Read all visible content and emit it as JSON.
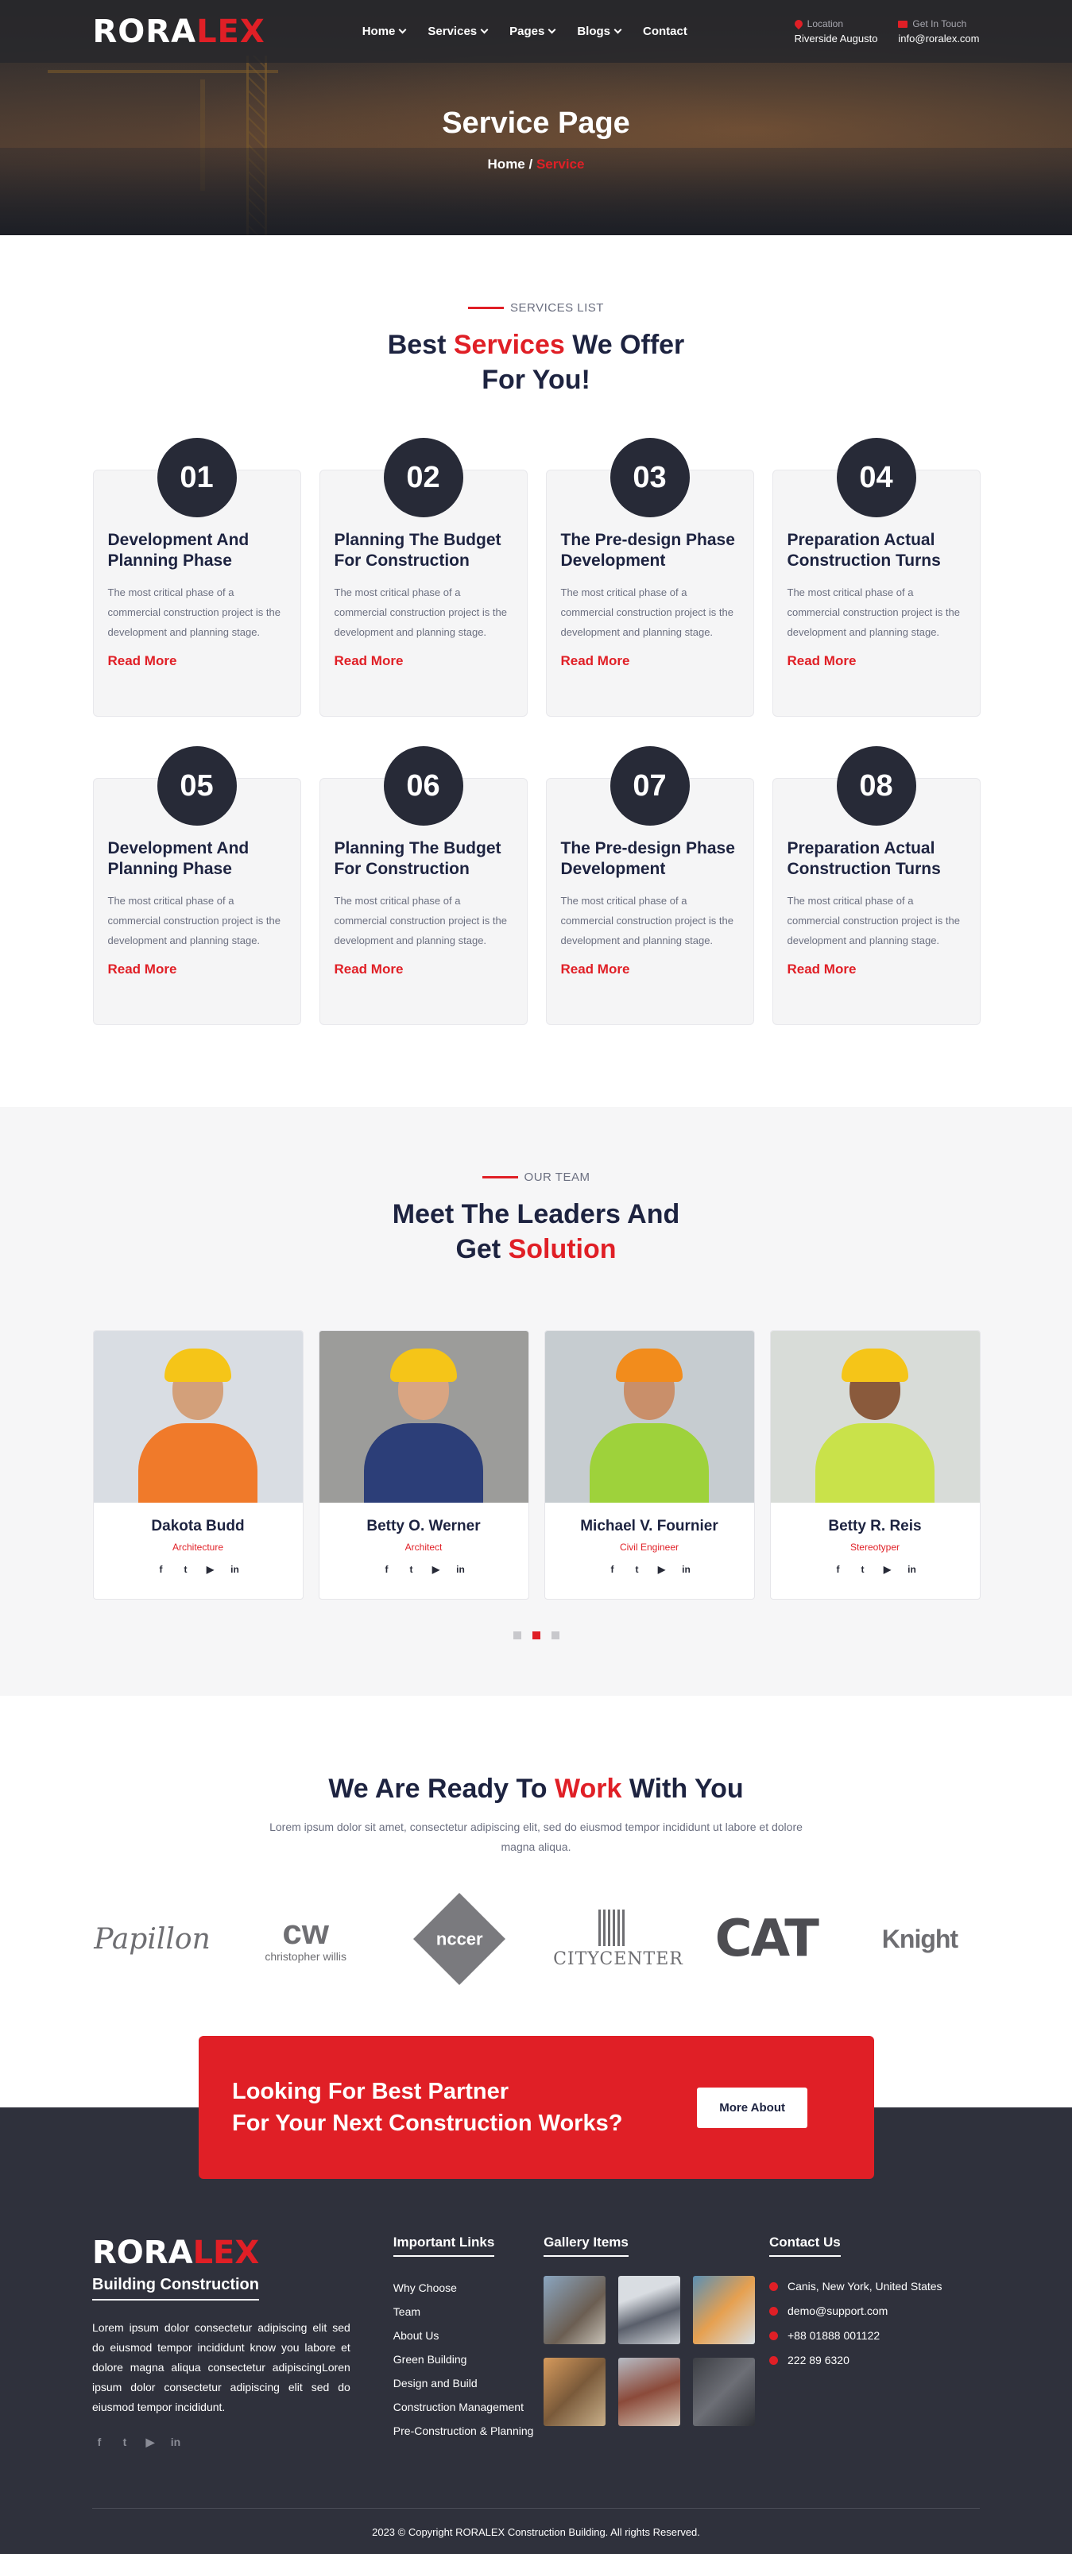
{
  "brand": {
    "logo_main": "RORA",
    "logo_accent": "LEX"
  },
  "nav": {
    "items": [
      "Home",
      "Services",
      "Pages",
      "Blogs",
      "Contact"
    ],
    "location_label": "Location",
    "location_value": "Riverside Augusto",
    "touch_label": "Get In Touch",
    "touch_value": "info@roralex.com"
  },
  "hero": {
    "title": "Service Page",
    "crumb_home": "Home",
    "crumb_sep": "/",
    "crumb_current": "Service"
  },
  "services": {
    "tag": "SERVICES LIST",
    "title_pre": "Best ",
    "title_accent": "Services",
    "title_post": " We Offer",
    "title_line2": "For You!",
    "cards": [
      {
        "num": "01",
        "title": "Development And Planning Phase",
        "text": "The most critical phase of a commercial construction project is the development and planning stage.",
        "link": "Read More"
      },
      {
        "num": "02",
        "title": "Planning The Budget For Construction",
        "text": "The most critical phase of a commercial construction project is the development and planning stage.",
        "link": "Read More"
      },
      {
        "num": "03",
        "title": "The Pre-design Phase Development",
        "text": "The most critical phase of a commercial construction project is the development and planning stage.",
        "link": "Read More"
      },
      {
        "num": "04",
        "title": "Preparation Actual Construction Turns",
        "text": "The most critical phase of a commercial construction project is the development and planning stage.",
        "link": "Read More"
      },
      {
        "num": "05",
        "title": "Development And Planning Phase",
        "text": "The most critical phase of a commercial construction project is the development and planning stage.",
        "link": "Read More"
      },
      {
        "num": "06",
        "title": "Planning The Budget For Construction",
        "text": "The most critical phase of a commercial construction project is the development and planning stage.",
        "link": "Read More"
      },
      {
        "num": "07",
        "title": "The Pre-design Phase Development",
        "text": "The most critical phase of a commercial construction project is the development and planning stage.",
        "link": "Read More"
      },
      {
        "num": "08",
        "title": "Preparation Actual Construction Turns",
        "text": "The most critical phase of a commercial construction project is the development and planning stage.",
        "link": "Read More"
      }
    ]
  },
  "team": {
    "tag": "OUR TEAM",
    "title_line1": "Meet The Leaders And",
    "title_pre2": "Get ",
    "title_accent2": "Solution",
    "members": [
      {
        "name": "Dakota Budd",
        "role": "Architecture"
      },
      {
        "name": "Betty O. Werner",
        "role": "Architect"
      },
      {
        "name": "Michael V. Fournier",
        "role": "Civil Engineer"
      },
      {
        "name": "Betty R. Reis",
        "role": "Stereotyper"
      }
    ],
    "social_icons": [
      "facebook-icon",
      "twitter-icon",
      "youtube-icon",
      "linkedin-icon"
    ]
  },
  "ready": {
    "title_pre": "We Are Ready To ",
    "title_accent": "Work",
    "title_post": " With You",
    "text": "Lorem ipsum dolor sit amet, consectetur adipiscing elit, sed do eiusmod tempor incididunt ut labore et dolore magna aliqua.",
    "brands": [
      "Papillon",
      "christopher willis",
      "nccer",
      "CITYCENTER",
      "CAT",
      "Knight"
    ]
  },
  "cta": {
    "line1": "Looking For Best Partner",
    "line2": "For Your Next Construction Works?",
    "button": "More About"
  },
  "footer": {
    "subtitle": "Building Construction",
    "desc": "Lorem ipsum dolor consectetur adipiscing elit sed do eiusmod tempor incididunt know you labore et dolore magna aliqua consectetur adipiscingLoren ipsum dolor consectetur adipiscing elit sed do eiusmod tempor incididunt.",
    "links_title": "Important Links",
    "links": [
      "Why Choose",
      "Team",
      "About Us",
      "Green Building",
      "Design and Build",
      "Construction Management",
      "Pre-Construction & Planning"
    ],
    "gallery_title": "Gallery Items",
    "contact_title": "Contact Us",
    "contact": [
      "Canis, New York, United States",
      "demo@support.com",
      "+88 01888 001122",
      "222 89 6320"
    ],
    "copyright": "2023 © Copyright RORALEX Construction Building. All rights Reserved."
  },
  "colors": {
    "accent": "#e01f26",
    "dark": "#272a37",
    "footer_bg": "#2f313c",
    "text": "#1d2340"
  }
}
